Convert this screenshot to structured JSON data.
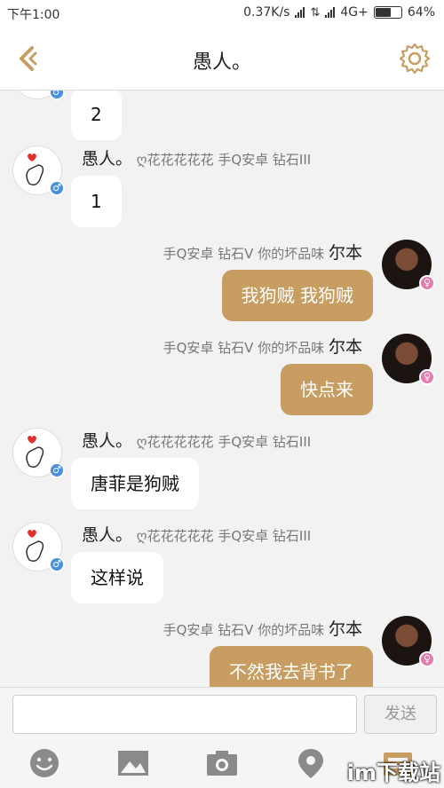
{
  "status_bar": {
    "time": "下午1:00",
    "speed": "0.37K/s",
    "network": "4G+",
    "battery": "64%",
    "battery_level": 0.64
  },
  "header": {
    "title": "愚人。"
  },
  "messages": [
    {
      "side": "left",
      "name": "",
      "tags": "",
      "text": "2"
    },
    {
      "side": "left",
      "name": "愚人。",
      "tags": "ღ花花花花花 手Q安卓 钻石III",
      "text": "1"
    },
    {
      "side": "right",
      "name": "尔本",
      "tags": "手Q安卓 钻石V 你的坏品味",
      "text": "我狗贼 我狗贼"
    },
    {
      "side": "right",
      "name": "尔本",
      "tags": "手Q安卓 钻石V 你的坏品味",
      "text": "快点来"
    },
    {
      "side": "left",
      "name": "愚人。",
      "tags": "ღ花花花花花 手Q安卓 钻石III",
      "text": "唐菲是狗贼"
    },
    {
      "side": "left",
      "name": "愚人。",
      "tags": "ღ花花花花花 手Q安卓 钻石III",
      "text": "这样说"
    },
    {
      "side": "right",
      "name": "尔本",
      "tags": "手Q安卓 钻石V 你的坏品味",
      "text": "不然我去背书了"
    }
  ],
  "input": {
    "placeholder": "",
    "send_label": "发送"
  },
  "toolbar": {
    "items": [
      "emoji-icon",
      "image-icon",
      "camera-icon",
      "location-icon",
      "more-icon"
    ]
  },
  "watermark": "im下载站",
  "colors": {
    "accent": "#c79d61",
    "male": "#4a8ee6",
    "female": "#e67bb0"
  }
}
